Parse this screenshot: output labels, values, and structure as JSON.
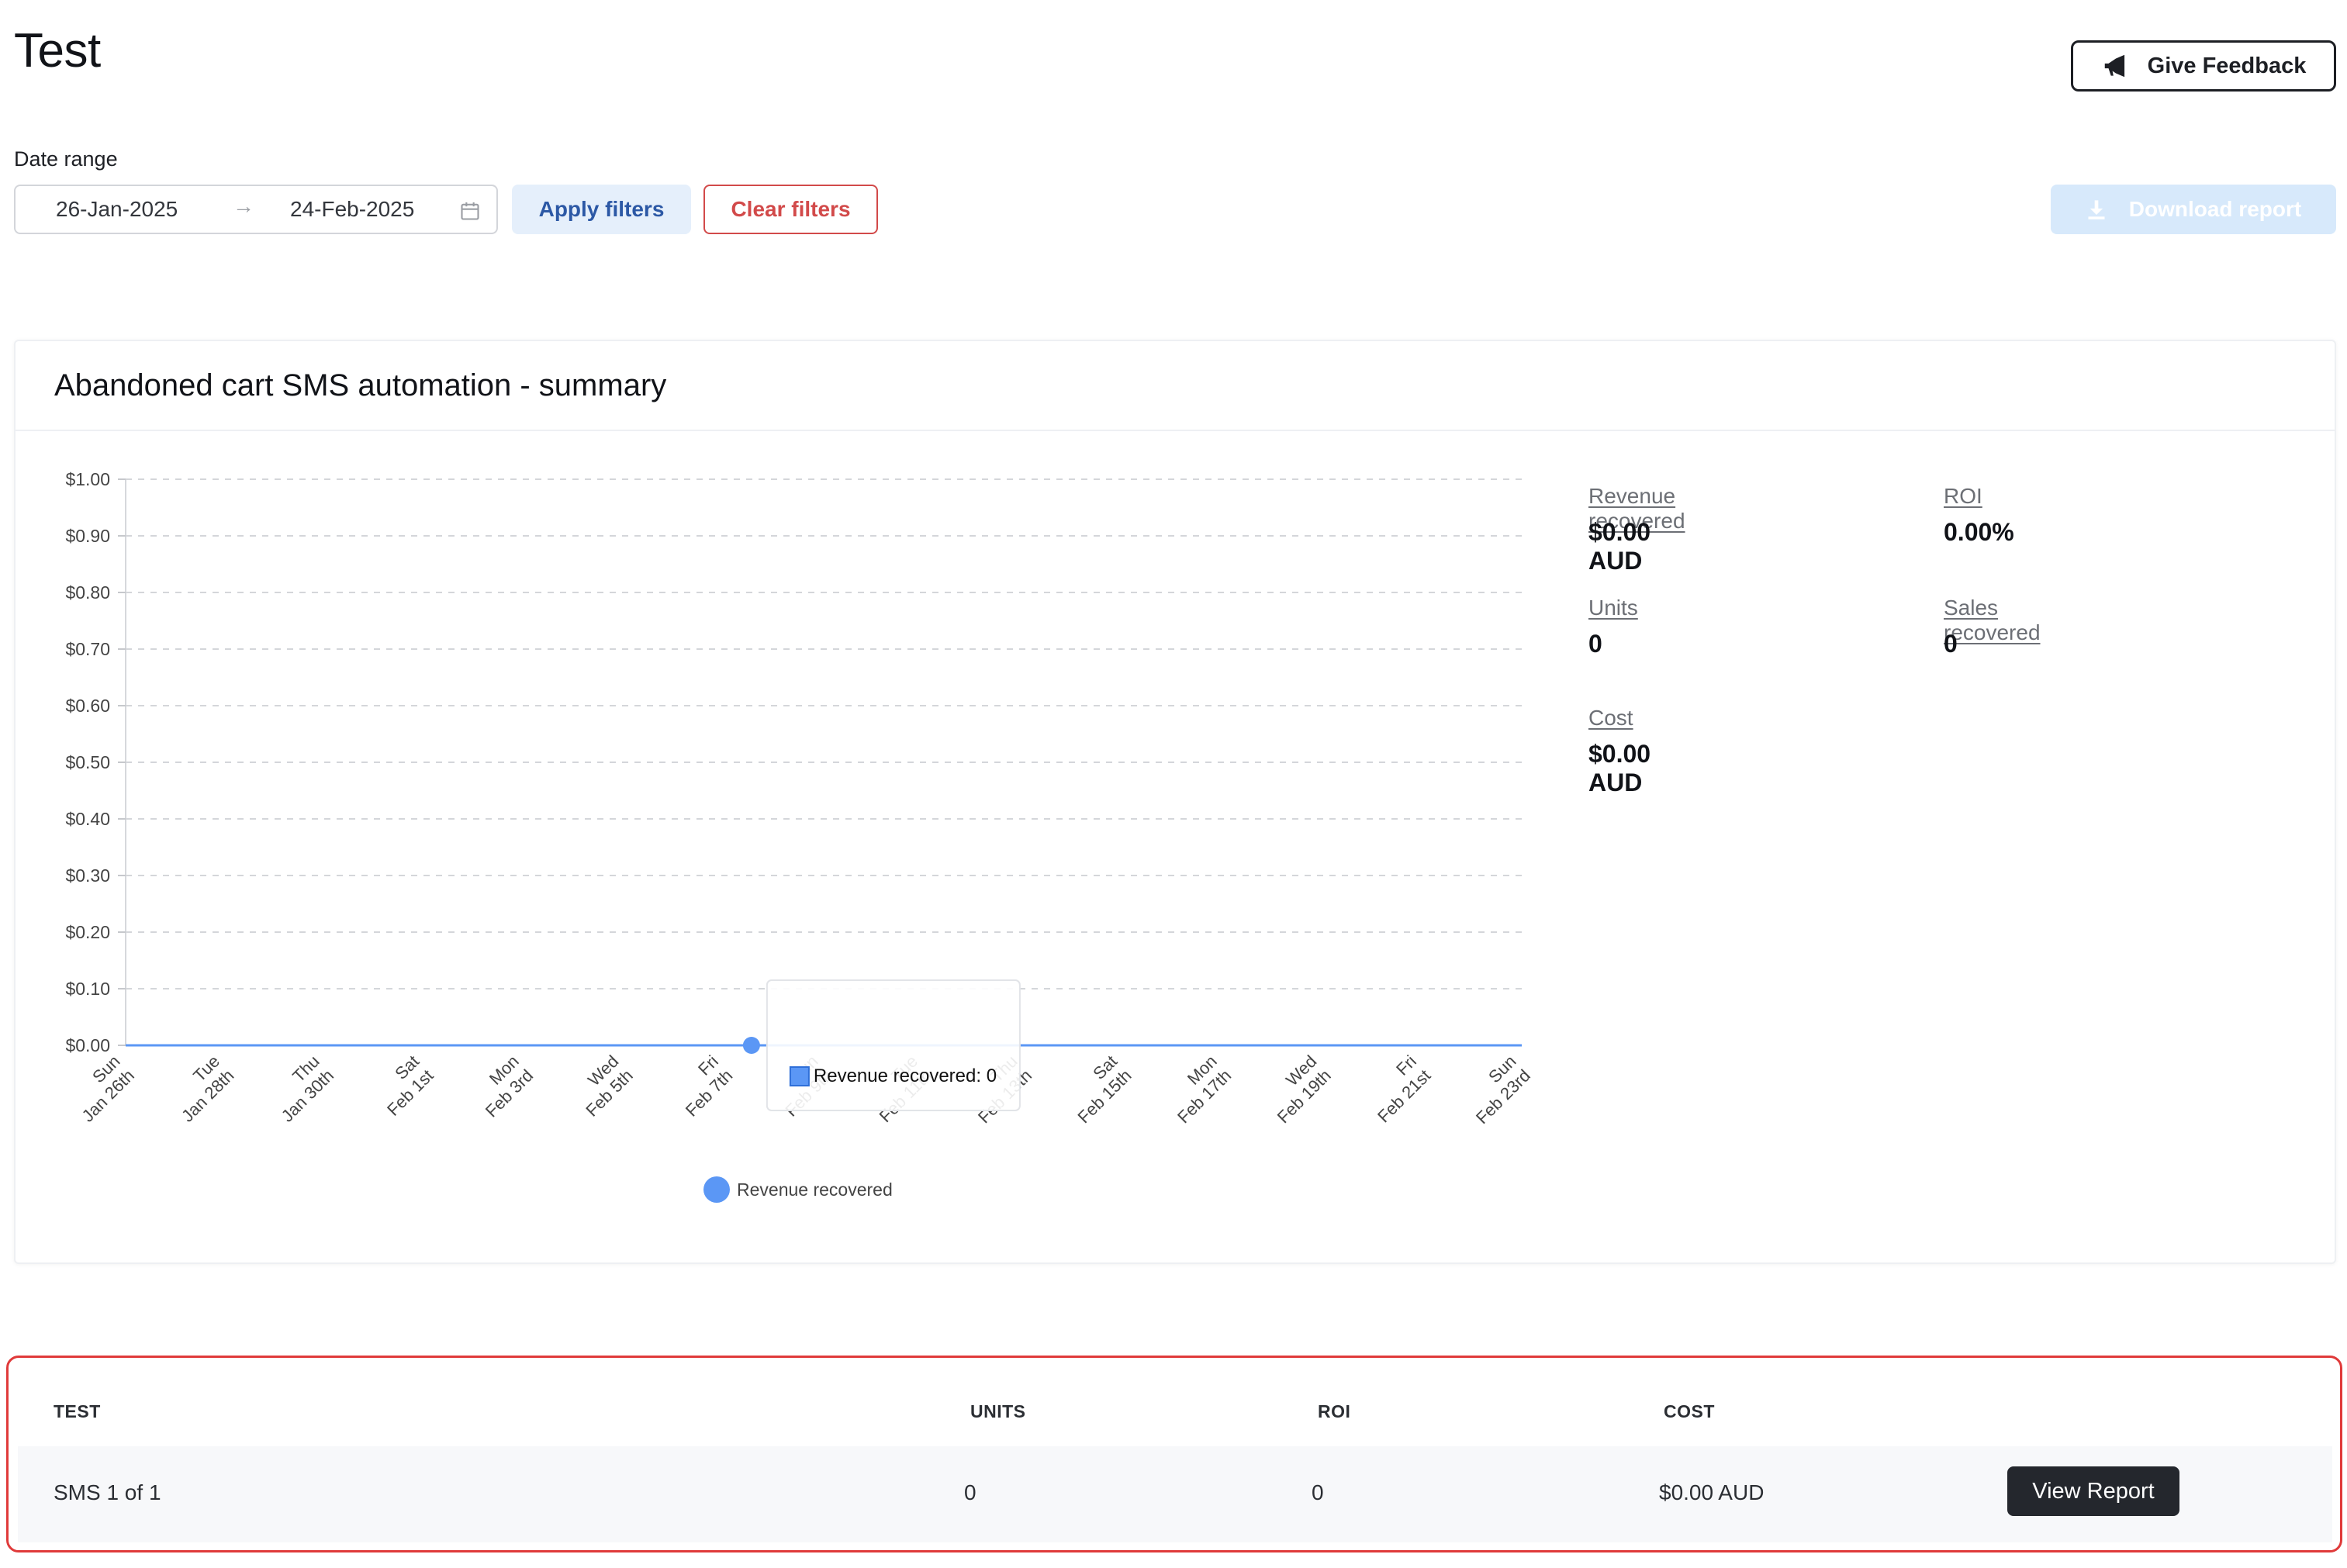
{
  "page": {
    "title": "Test"
  },
  "header": {
    "feedback_label": "Give Feedback",
    "feedback_icon": "megaphone-icon"
  },
  "filters": {
    "date_label": "Date range",
    "start_date": "26-Jan-2025",
    "end_date": "24-Feb-2025",
    "separator": "→",
    "apply_label": "Apply filters",
    "clear_label": "Clear filters",
    "download_label": "Download report"
  },
  "colors": {
    "accent": "#5b97f5",
    "danger": "#d24a4a",
    "apply_bg": "#e5effb",
    "download_bg": "#d7e9fb",
    "dark_button": "#24272d"
  },
  "summary": {
    "title": "Abandoned cart SMS automation - summary",
    "stats": [
      {
        "label": "Revenue recovered",
        "value": "$0.00 AUD"
      },
      {
        "label": "ROI",
        "value": "0.00%"
      },
      {
        "label": "Units",
        "value": "0"
      },
      {
        "label": "Sales recovered",
        "value": "0"
      },
      {
        "label": "Cost",
        "value": "$0.00 AUD"
      }
    ]
  },
  "chart_data": {
    "type": "line",
    "title": "",
    "xlabel": "",
    "ylabel": "",
    "ylim": [
      0,
      1
    ],
    "grid": true,
    "legend_placement": "bottom",
    "y_ticks": [
      "$1.00",
      "$0.90",
      "$0.80",
      "$0.70",
      "$0.60",
      "$0.50",
      "$0.40",
      "$0.30",
      "$0.20",
      "$0.10",
      "$0.00"
    ],
    "x_tick_labels": [
      [
        "Sun",
        "Jan 26th"
      ],
      [
        "Tue",
        "Jan 28th"
      ],
      [
        "Thu",
        "Jan 30th"
      ],
      [
        "Sat",
        "Feb 1st"
      ],
      [
        "Mon",
        "Feb 3rd"
      ],
      [
        "Wed",
        "Feb 5th"
      ],
      [
        "Fri",
        "Feb 7th"
      ],
      [
        "Sun",
        "Feb 9th"
      ],
      [
        "Tue",
        "Feb 11th"
      ],
      [
        "Thu",
        "Feb 13th"
      ],
      [
        "Sat",
        "Feb 15th"
      ],
      [
        "Mon",
        "Feb 17th"
      ],
      [
        "Wed",
        "Feb 19th"
      ],
      [
        "Fri",
        "Feb 21st"
      ],
      [
        "Sun",
        "Feb 23rd"
      ]
    ],
    "series": [
      {
        "name": "Revenue recovered",
        "color": "#5b97f5",
        "x": [
          "Jan 26",
          "Jan 27",
          "Jan 28",
          "Jan 29",
          "Jan 30",
          "Jan 31",
          "Feb 1",
          "Feb 2",
          "Feb 3",
          "Feb 4",
          "Feb 5",
          "Feb 6",
          "Feb 7",
          "Feb 8",
          "Feb 9",
          "Feb 10",
          "Feb 11",
          "Feb 12",
          "Feb 13",
          "Feb 14",
          "Feb 15",
          "Feb 16",
          "Feb 17",
          "Feb 18",
          "Feb 19",
          "Feb 20",
          "Feb 21",
          "Feb 22",
          "Feb 23",
          "Feb 24"
        ],
        "values": [
          0,
          0,
          0,
          0,
          0,
          0,
          0,
          0,
          0,
          0,
          0,
          0,
          0,
          0,
          0,
          0,
          0,
          0,
          0,
          0,
          0,
          0,
          0,
          0,
          0,
          0,
          0,
          0,
          0,
          0
        ]
      }
    ],
    "highlighted_index": 13,
    "tooltip_text": "Revenue recovered: 0"
  },
  "table": {
    "headers": [
      "TEST",
      "UNITS",
      "ROI",
      "COST"
    ],
    "rows": [
      {
        "test": "SMS 1 of 1",
        "units": "0",
        "roi": "0",
        "cost": "$0.00 AUD",
        "action": "View Report"
      }
    ]
  }
}
